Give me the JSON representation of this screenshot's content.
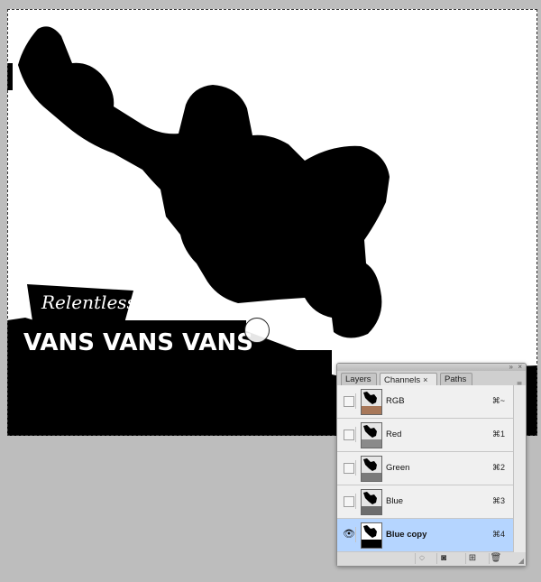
{
  "channels_panel": {
    "tabs": [
      {
        "label": "Layers"
      },
      {
        "label": "Channels",
        "close": "×"
      },
      {
        "label": "Paths"
      }
    ],
    "menu_icon": "≡",
    "collapse_icon": "»",
    "close_icon": "×",
    "rows": [
      {
        "label": "RGB",
        "shortcut": "⌘~",
        "visible": false,
        "selected": false,
        "thumb_tint": "#a8785a"
      },
      {
        "label": "Red",
        "shortcut": "⌘1",
        "visible": false,
        "selected": false,
        "thumb_tint": "#8a8a8a"
      },
      {
        "label": "Green",
        "shortcut": "⌘2",
        "visible": false,
        "selected": false,
        "thumb_tint": "#7a7a7a"
      },
      {
        "label": "Blue",
        "shortcut": "⌘3",
        "visible": false,
        "selected": false,
        "thumb_tint": "#6d6d6d"
      },
      {
        "label": "Blue copy",
        "shortcut": "⌘4",
        "visible": true,
        "selected": true,
        "thumb_tint": "#000000"
      }
    ],
    "eye_glyph": "👁",
    "bottom_icons": [
      {
        "name": "load-selection-icon",
        "glyph": "◌"
      },
      {
        "name": "save-selection-icon",
        "glyph": "◙"
      },
      {
        "name": "new-channel-icon",
        "glyph": "⊞"
      },
      {
        "name": "delete-channel-icon",
        "glyph": "🗑"
      }
    ]
  },
  "canvas": {
    "sign_text_top": "Relentless",
    "sign_text_banner": "VANS VANS VANS"
  },
  "colors": {
    "selection_highlight": "#b5d5ff",
    "canvas_bg": "#ffffff",
    "workspace_bg": "#bdbdbd"
  }
}
